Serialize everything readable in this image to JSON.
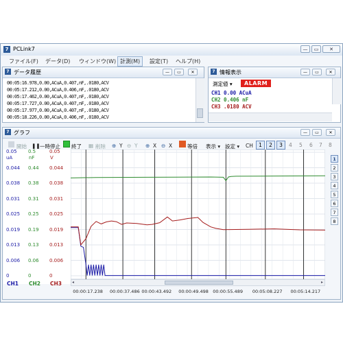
{
  "window": {
    "title": "PCLink7"
  },
  "menu": [
    "ファイル(F)",
    "データ(D)",
    "ウィンドウ(W)",
    "計測(M)",
    "設定(T)",
    "ヘルプ(H)"
  ],
  "history_panel": {
    "title": "データ履歴",
    "rows": [
      "00:05:16.978,0.00,ACuA,0.407,nF,.0180,ACV",
      "00:05:17.212,0.00,ACuA,0.406,nF,.0180,ACV",
      "00:05:17.462,0.00,ACuA,0.407,nF,.0180,ACV",
      "00:05:17.727,0.00,ACuA,0.407,nF,.0180,ACV",
      "00:05:17.977,0.00,ACuA,0.407,nF,.0180,ACV",
      "00:05:18.226,0.00,ACuA,0.406,nF,.0180,ACV"
    ]
  },
  "info_panel": {
    "title": "情報表示",
    "measure_label": "測定値",
    "alarm_label": "ALARM",
    "ch1": "CH1  0.00  ACuA",
    "ch2": "CH2  0.406  nF",
    "ch3": "CH3  .0180  ACV"
  },
  "graph_panel": {
    "title": "グラフ",
    "toolbar": {
      "start": "開始",
      "pause": "一時停止",
      "stop": "終了",
      "delete": "削除",
      "y_zoom_in": "Y",
      "y_zoom_out": "Y",
      "x_zoom_in": "X",
      "x_zoom_out": "X",
      "equal": "等倍",
      "display": "表示",
      "settings": "設定",
      "ch_label": "CH",
      "channels": [
        "1",
        "2",
        "3",
        "4",
        "5",
        "6",
        "7",
        "8"
      ]
    },
    "side_channels": [
      "1",
      "2",
      "3",
      "4",
      "5",
      "6",
      "7",
      "8"
    ]
  },
  "colors": {
    "ch1": "#1a1aa6",
    "ch2": "#2e8b2e",
    "ch3": "#a51c1c",
    "alarm_bg": "#e0201c"
  },
  "chart_data": {
    "type": "line",
    "legend": [
      "CH1",
      "CH2",
      "CH3"
    ],
    "axes": [
      {
        "name": "CH1",
        "unit": "uA",
        "ticks": [
          "0.05",
          "0.044",
          "0.038",
          "0.031",
          "0.025",
          "0.019",
          "0.013",
          "0.006",
          "0"
        ]
      },
      {
        "name": "CH2",
        "unit": "nF",
        "ticks": [
          "0.5",
          "0.44",
          "0.38",
          "0.31",
          "0.25",
          "0.19",
          "0.13",
          "0.06",
          "0"
        ]
      },
      {
        "name": "CH3",
        "unit": "V",
        "ticks": [
          "0.05",
          "0.044",
          "0.038",
          "0.031",
          "0.025",
          "0.019",
          "0.013",
          "0.006",
          "0"
        ]
      }
    ],
    "x_ticks": [
      "00:00:17.238",
      "00:00:37.486",
      "00:00:43.492",
      "00:00:49.498",
      "00:00:55.489",
      "00:05:08.227",
      "00:05:14.217"
    ],
    "ylim": [
      0,
      0.05
    ],
    "series": [
      {
        "name": "CH1",
        "x": [
          0,
          1,
          2,
          3,
          4,
          5,
          6,
          6.5,
          7,
          7.5,
          8,
          8.5,
          9,
          9.5,
          10,
          10.5,
          11,
          11.5,
          12,
          12.5,
          13,
          13.5,
          14,
          15,
          20,
          40,
          60,
          80,
          100
        ],
        "y": [
          0.0195,
          0.0195,
          0.0195,
          0.0195,
          0.012,
          0.0115,
          0.0045,
          0.0001,
          0.0045,
          0.0001,
          0.0045,
          0.0001,
          0.0045,
          0.0001,
          0.0045,
          0.0001,
          0.0045,
          0.0001,
          0.0045,
          0.0001,
          0.0045,
          0.0001,
          0.0001,
          0.0001,
          0.0001,
          0.0001,
          0.0001,
          0.0001,
          0.0001
        ]
      },
      {
        "name": "CH2",
        "x": [
          0,
          10,
          30,
          55,
          60,
          61,
          62,
          63,
          65,
          80,
          100
        ],
        "y": [
          0.396,
          0.398,
          0.399,
          0.4,
          0.399,
          0.385,
          0.4,
          0.402,
          0.403,
          0.404,
          0.405
        ]
      },
      {
        "name": "CH3",
        "x": [
          0,
          3,
          4,
          6,
          8,
          10,
          12,
          14,
          16,
          18,
          20,
          22,
          26,
          30,
          32,
          35,
          38,
          40,
          43,
          46,
          50,
          52,
          55,
          57,
          60,
          70,
          80,
          90,
          100
        ],
        "y": [
          0.0198,
          0.0198,
          0.0125,
          0.015,
          0.02,
          0.022,
          0.021,
          0.0218,
          0.0222,
          0.0219,
          0.0208,
          0.0214,
          0.0212,
          0.0206,
          0.0208,
          0.0215,
          0.0238,
          0.0222,
          0.0226,
          0.0232,
          0.0236,
          0.0216,
          0.0198,
          0.0192,
          0.0187,
          0.0188,
          0.019,
          0.0186,
          0.0185
        ]
      }
    ],
    "markers_x": [
      6,
      20.5,
      33,
      47.5,
      61,
      76.5,
      91.5
    ]
  }
}
